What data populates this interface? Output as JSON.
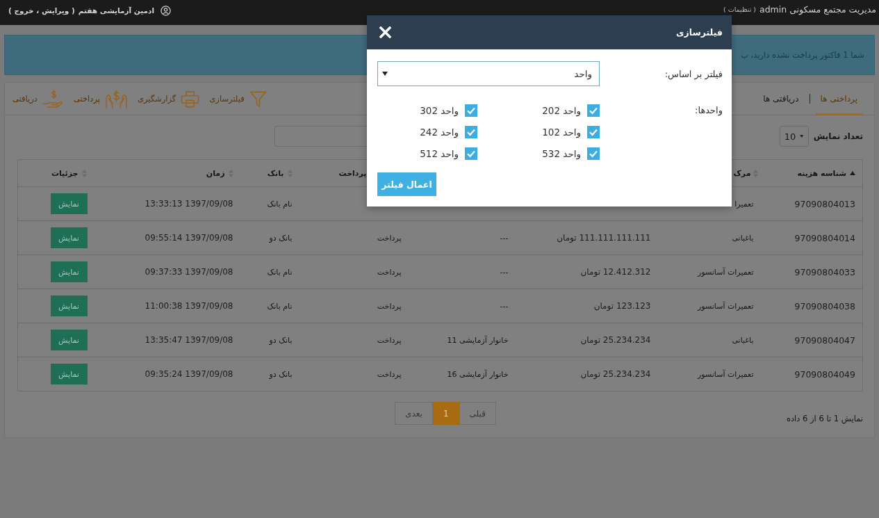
{
  "top_bar": {
    "title": "مدیریت مجتمع مسکونی admin",
    "settings_link": "( تنظیمات )",
    "user_name": "ادمین آزمایشی هفتم",
    "account_links": "( ویرایش ، خروج )"
  },
  "alert": {
    "text": "شما 1 فاکتور پرداخت نشده دارید، ب"
  },
  "tabs": [
    {
      "label": "پرداختی ها",
      "selected": true
    },
    {
      "label": "دریافتی ها",
      "selected": false
    }
  ],
  "toolbar": [
    {
      "kind": "filter",
      "label": "فیلترسازی"
    },
    {
      "kind": "print",
      "label": "گزارشگیری"
    },
    {
      "kind": "pay",
      "label": "پرداختی"
    },
    {
      "kind": "receive",
      "label": "دریافتی"
    }
  ],
  "page_size": {
    "label": "تعداد نمایش",
    "value": "10"
  },
  "table": {
    "columns": [
      {
        "label": "شناسه هزینه",
        "sorted": true
      },
      {
        "label": "مرک",
        "sorted": false
      },
      null,
      null,
      {
        "label": "پرداخت"
      },
      {
        "label": "بانک",
        "sorted": false
      },
      {
        "label": "زمان",
        "sorted": false
      },
      {
        "label": "جزئیات",
        "sorted": false
      }
    ],
    "rows": [
      {
        "cells": [
          "97090804013",
          "تعمیرا",
          null,
          null,
          null,
          "نام بانک",
          "1397/09/08 13:33:13"
        ],
        "action": "نمایش"
      },
      {
        "cells": [
          "97090804014",
          "باغبانی",
          "111.111.111.111 تومان",
          "---",
          "پرداخت",
          "بانک دو",
          "1397/09/08 09:55:14"
        ],
        "action": "نمایش"
      },
      {
        "cells": [
          "97090804033",
          "تعمیرات آسانسور",
          "12.412.312 تومان",
          "---",
          "پرداخت",
          "نام بانک",
          "1397/09/08 09:37:33"
        ],
        "action": "نمایش"
      },
      {
        "cells": [
          "97090804038",
          "تعمیرات آسانسور",
          "123.123 تومان",
          "---",
          "پرداخت",
          "نام بانک",
          "1397/09/08 11:00:38"
        ],
        "action": "نمایش"
      },
      {
        "cells": [
          "97090804047",
          "باغبانی",
          "25.234.234 تومان",
          "خانوار آزمایشی 11",
          "پرداخت",
          "بانک دو",
          "1397/09/08 13:35:47"
        ],
        "action": "نمایش"
      },
      {
        "cells": [
          "97090804049",
          "تعمیرات آسانسور",
          "25.234.234 تومان",
          "خانوار آزمایشی 16",
          "پرداخت",
          "بانک دو",
          "1397/09/08 09:35:24"
        ],
        "action": "نمایش"
      }
    ],
    "summary": "نمایش 1 تا 6 از 6 داده"
  },
  "pagination": [
    {
      "label": "قبلی",
      "selected": false,
      "disabled": true
    },
    {
      "label": "1",
      "selected": true,
      "disabled": false
    },
    {
      "label": "بعدی",
      "selected": false,
      "disabled": true
    }
  ],
  "modal": {
    "title": "فیلترسازی",
    "filter_by": {
      "label": "فیلتر بر اساس:",
      "value": "واحد"
    },
    "units": {
      "label": "واحدها:",
      "items": [
        {
          "label": "واحد 202",
          "checked": true
        },
        {
          "label": "واحد 302",
          "checked": true
        },
        {
          "label": "واحد 102",
          "checked": true
        },
        {
          "label": "واحد 242",
          "checked": true
        },
        {
          "label": "واحد 532",
          "checked": true
        },
        {
          "label": "واحد 512",
          "checked": true
        }
      ]
    },
    "apply_button": "اعمال فیلتر"
  }
}
